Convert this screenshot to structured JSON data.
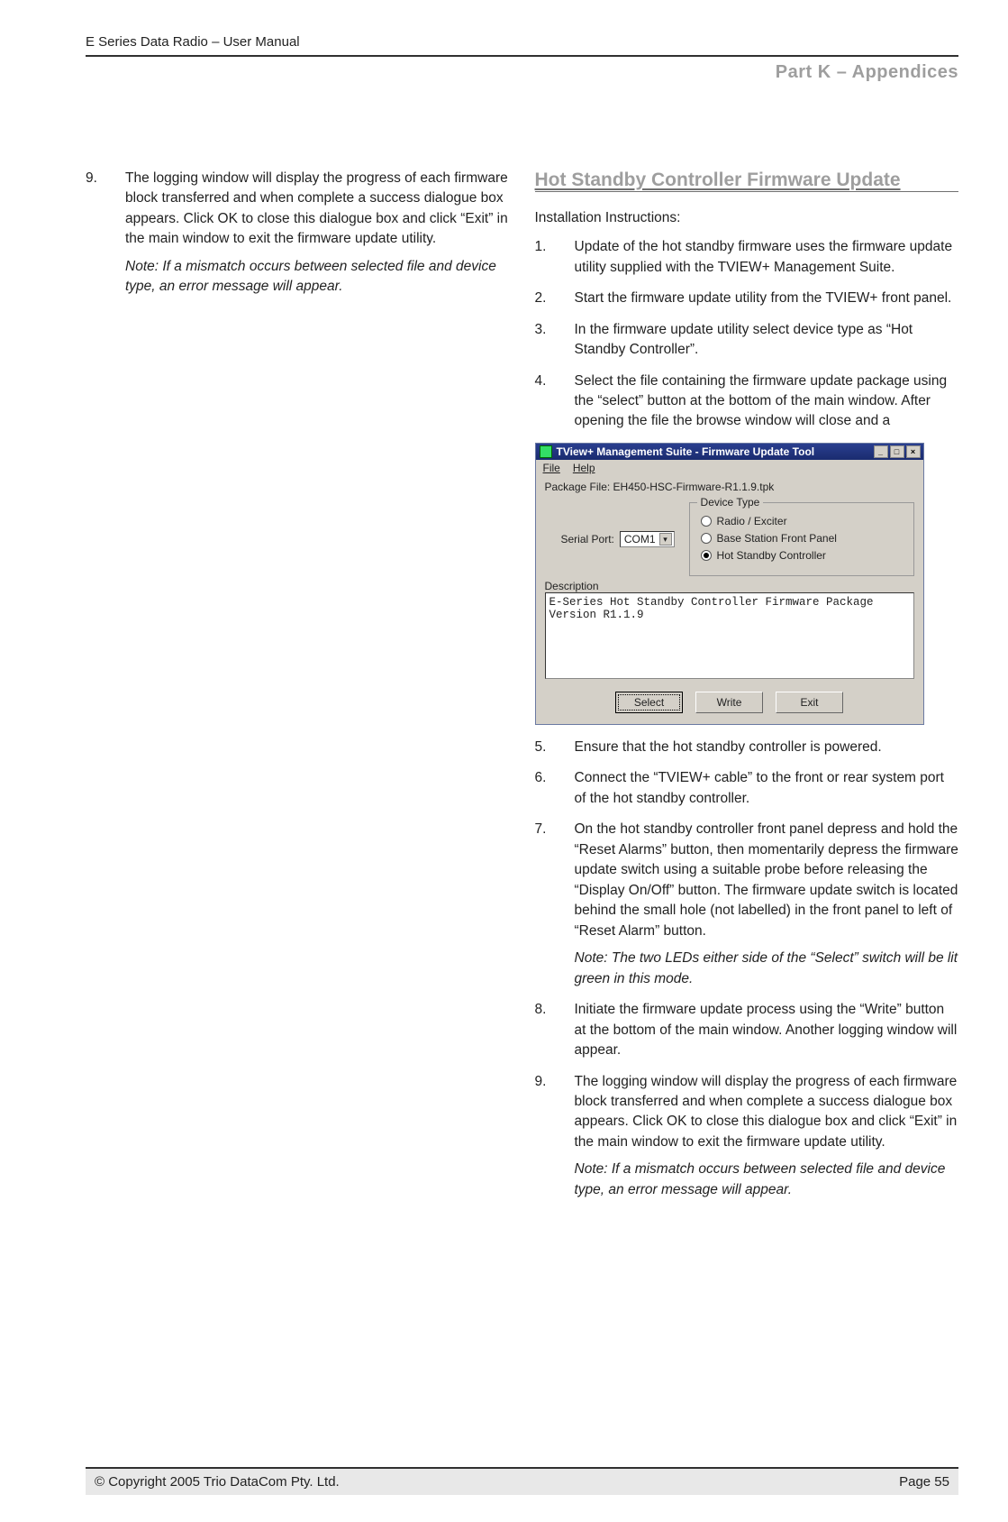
{
  "header": {
    "manual_title": "E Series Data Radio – User Manual"
  },
  "part_label": "Part K – Appendices",
  "left": {
    "item9": {
      "num": "9.",
      "text": "The logging window will display the progress of each firmware block transferred and when complete a success dialogue box appears. Click OK to close this dialogue box and click “Exit” in the main window to exit the firmware update utility.",
      "note": "Note: If a mismatch occurs between selected file and device type, an error message will appear."
    }
  },
  "right": {
    "heading": "Hot Standby Controller Firmware Update",
    "intro": "Installation Instructions:",
    "items": {
      "i1": {
        "num": "1.",
        "text": "Update of the hot standby firmware uses the firmware update utility supplied with the TVIEW+ Management Suite."
      },
      "i2": {
        "num": "2.",
        "text": "Start the firmware update utility from the TVIEW+ front panel."
      },
      "i3": {
        "num": "3.",
        "text": "In the firmware update utility select device type as “Hot Standby Controller”."
      },
      "i4": {
        "num": "4.",
        "text": "Select the file containing the firmware update package using the “select” button at the bottom of the main window. After opening the file the browse window will close and a"
      },
      "i5": {
        "num": "5.",
        "text": "Ensure that the hot standby controller is powered."
      },
      "i6": {
        "num": "6.",
        "text": "Connect the “TVIEW+ cable” to the front or rear system port of the hot standby controller."
      },
      "i7": {
        "num": "7.",
        "text": "On the hot standby controller front panel depress and hold the “Reset Alarms” button, then momentarily depress the firmware update switch using a suitable probe before releasing the “Display On/Off” button. The firmware update switch is located behind the small hole (not labelled) in the front panel to left of “Reset Alarm” button.",
        "note": "Note: The two LEDs either side of the “Select” switch will be lit green in this mode."
      },
      "i8": {
        "num": "8.",
        "text": "Initiate the firmware update process using the “Write” button at the bottom of the main window. Another logging window will appear."
      },
      "i9": {
        "num": "9.",
        "text": "The logging window will display the progress of each firmware block transferred and when complete a success dialogue box appears. Click OK to close this dialogue box and click “Exit” in the main window to exit the firmware update utility.",
        "note": "Note: If a mismatch occurs between selected file and device type, an error message will appear."
      }
    }
  },
  "fwtool": {
    "title": "TView+ Management Suite - Firmware Update Tool",
    "menu": {
      "file": "File",
      "help": "Help"
    },
    "package_label": "Package File:",
    "package_file": "EH450-HSC-Firmware-R1.1.9.tpk",
    "serial_label": "Serial Port:",
    "serial_value": "COM1",
    "group_title": "Device Type",
    "radios": {
      "r1": "Radio / Exciter",
      "r2": "Base Station Front Panel",
      "r3": "Hot Standby Controller"
    },
    "desc_label": "Description",
    "desc_text": "E-Series Hot Standby Controller Firmware Package\nVersion R1.1.9",
    "buttons": {
      "select": "Select",
      "write": "Write",
      "exit": "Exit"
    },
    "winbtns": {
      "min": "_",
      "max": "□",
      "close": "×"
    }
  },
  "footer": {
    "copyright": "© Copyright 2005 Trio DataCom Pty. Ltd.",
    "page": "Page 55"
  }
}
